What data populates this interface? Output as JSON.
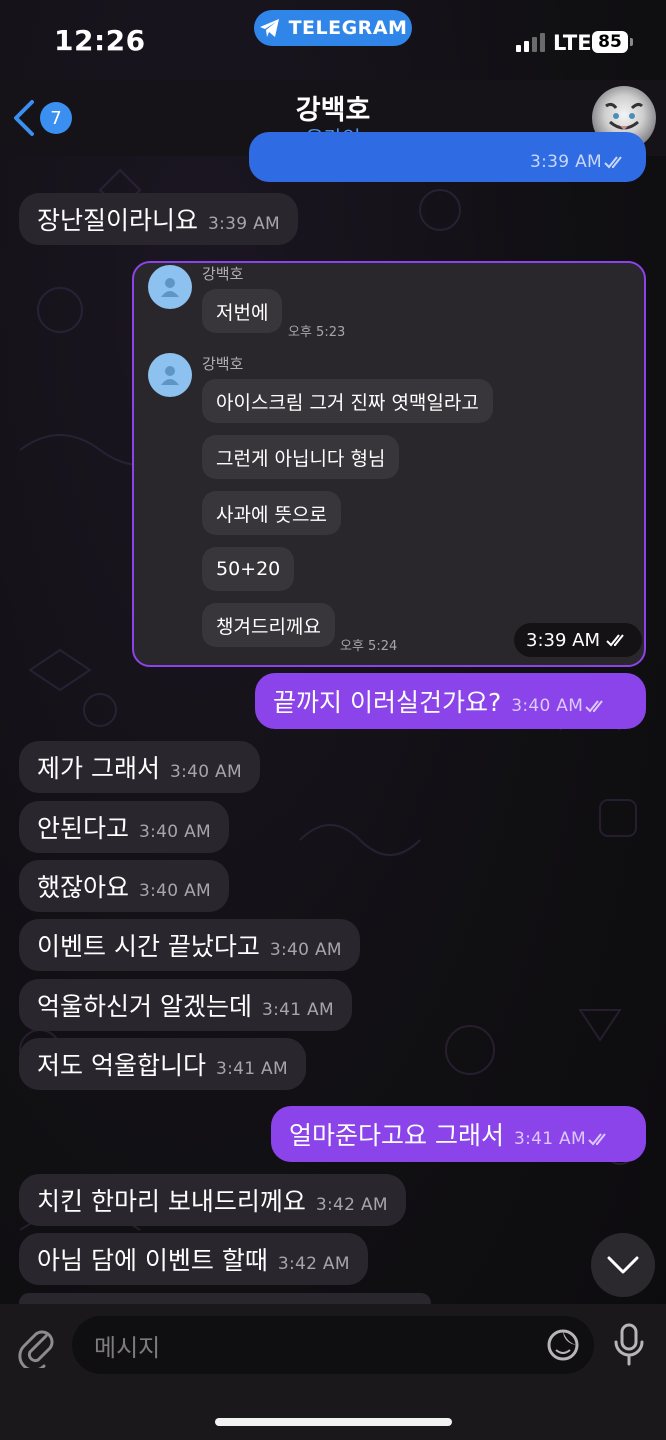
{
  "status_bar": {
    "time": "12:26",
    "carrier_pill": "TELEGRAM",
    "network": "LTE",
    "battery": "85"
  },
  "header": {
    "back_count": "7",
    "name": "강백호",
    "status": "온라인"
  },
  "messages": [
    {
      "text": "장난질이라니요",
      "time": "3:39 AM"
    },
    {
      "text": "끝까지 이러실건가요?",
      "time": "3:40 AM"
    },
    {
      "text": "제가 그래서",
      "time": "3:40 AM"
    },
    {
      "text": "안된다고",
      "time": "3:40 AM"
    },
    {
      "text": "했잖아요",
      "time": "3:40 AM"
    },
    {
      "text": "이벤트 시간 끝났다고",
      "time": "3:40 AM"
    },
    {
      "text": "억울하신거 알겠는데",
      "time": "3:41 AM"
    },
    {
      "text": "저도 억울합니다",
      "time": "3:41 AM"
    },
    {
      "text": "얼마준다고요 그래서",
      "time": "3:41 AM"
    },
    {
      "text": "치킨 한마리 보내드리께요",
      "time": "3:42 AM"
    },
    {
      "text": "아님 담에 이벤트 할때",
      "time": "3:42 AM"
    }
  ],
  "top_partial_time": "3:39 AM",
  "forwarded": {
    "sender": "강백호",
    "time": "3:39 AM",
    "group1": [
      {
        "text": "저번에"
      }
    ],
    "group1_time": "오후 5:23",
    "group2": [
      {
        "text": "아이스크림 그거 진짜 엿맥일라고"
      },
      {
        "text": "그런게 아닙니다 형님"
      },
      {
        "text": "사과에 뜻으로"
      },
      {
        "text": "50+20"
      },
      {
        "text": "챙겨드리께요"
      }
    ],
    "group2_time": "오후 5:24"
  },
  "input": {
    "placeholder": "메시지"
  },
  "colors": {
    "outgoing": "#8a44ea",
    "outgoing_alt": "#2f6be3",
    "incoming": "#2a262d",
    "accent": "#3a8ff0"
  },
  "icons": [
    "telegram-icon",
    "back-chevron-icon",
    "paperclip-icon",
    "sticker-icon",
    "microphone-icon",
    "chevron-down-icon",
    "double-check-icon"
  ]
}
